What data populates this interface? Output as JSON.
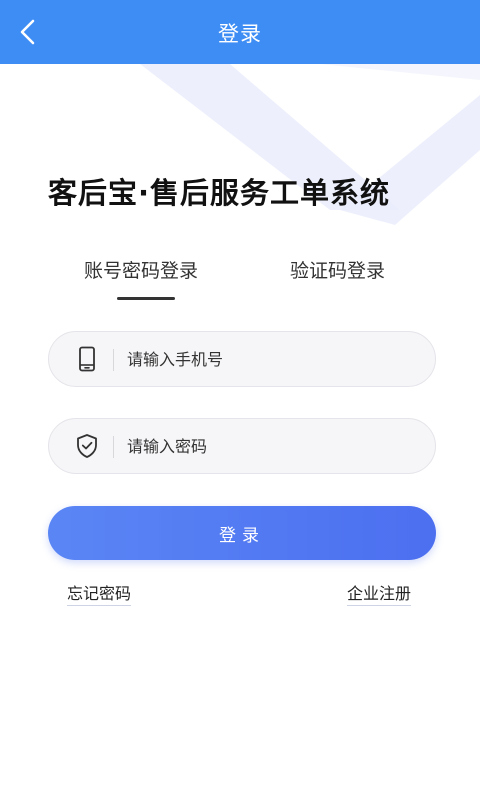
{
  "header": {
    "title": "登录",
    "back_icon": "chevron-left-icon",
    "background_color": "#3d8df5"
  },
  "app_title": "客后宝·售后服务工单系统",
  "tabs": [
    {
      "label": "账号密码登录",
      "active": true
    },
    {
      "label": "验证码登录",
      "active": false
    }
  ],
  "form": {
    "phone": {
      "placeholder": "请输入手机号",
      "value": "",
      "icon": "phone-icon"
    },
    "password": {
      "placeholder": "请输入密码",
      "value": "",
      "icon": "shield-check-icon"
    }
  },
  "login_button": {
    "label": "登录",
    "color": "#5277f2"
  },
  "links": {
    "forgot_password": "忘记密码",
    "enterprise_register": "企业注册"
  }
}
